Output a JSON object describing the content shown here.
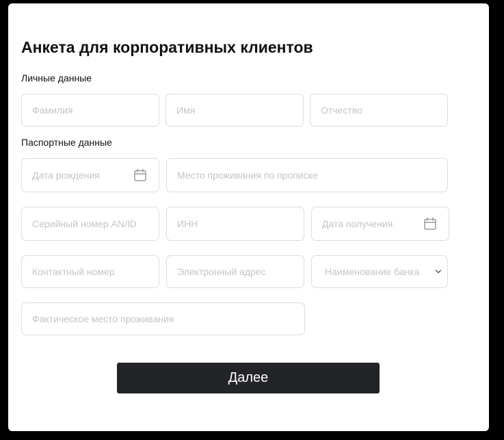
{
  "form": {
    "title": "Анкета для корпоративных клиентов",
    "sections": {
      "personal_label": "Личные данные",
      "passport_label": "Паспортные данные"
    },
    "fields": {
      "last_name": {
        "placeholder": "Фамилия",
        "value": ""
      },
      "first_name": {
        "placeholder": "Имя",
        "value": ""
      },
      "patronymic": {
        "placeholder": "Отчество",
        "value": ""
      },
      "birth_date": {
        "placeholder": "Дата рождения",
        "value": "",
        "icon": "calendar-icon"
      },
      "registration_address": {
        "placeholder": "Место проживания по прописке",
        "value": ""
      },
      "serial_number": {
        "placeholder": "Серийный номер AN/ID",
        "value": ""
      },
      "inn": {
        "placeholder": "ИНН",
        "value": ""
      },
      "issue_date": {
        "placeholder": "Дата получения",
        "value": "",
        "icon": "calendar-icon"
      },
      "contact_number": {
        "placeholder": "Контактный номер",
        "value": ""
      },
      "email": {
        "placeholder": "Электронный адрес",
        "value": ""
      },
      "bank_name": {
        "selected": "Наименование банка",
        "icon": "chevron-down-icon"
      },
      "actual_address": {
        "placeholder": "Фактическое место проживания",
        "value": ""
      }
    },
    "submit_label": "Далее"
  },
  "colors": {
    "page_background": "#000000",
    "card_background": "#ffffff",
    "field_border": "#dcdcdc",
    "placeholder": "#c4c4c4",
    "button_background": "#232427",
    "button_text": "#ffffff",
    "text": "#111111"
  }
}
